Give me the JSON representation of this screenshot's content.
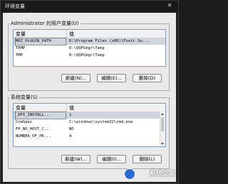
{
  "window": {
    "title": "环境变量",
    "close_glyph": "✕"
  },
  "user_vars": {
    "legend": "Administrator 的用户变量(U)",
    "columns": [
      "变量",
      "值"
    ],
    "rows": [
      {
        "name": "MOZ_PLUGIN_PATH",
        "value": "D:\\Program Files (x86)\\Foxit So...",
        "selected": true
      },
      {
        "name": "TEMP",
        "value": "D:\\QQPCmgr\\Temp"
      },
      {
        "name": "TMP",
        "value": "D:\\QQPCmgr\\Temp"
      }
    ],
    "buttons": {
      "new": "新建(N)...",
      "edit": "编辑(E)...",
      "delete": "删除(D)"
    }
  },
  "sys_vars": {
    "legend": "系统变量(S)",
    "columns": [
      "变量",
      "值"
    ],
    "rows": [
      {
        "name": "_DFX_INSTALL...",
        "value": "1",
        "selected": true
      },
      {
        "name": "ComSpec",
        "value": "C:\\windows\\system32\\cmd.exe"
      },
      {
        "name": "FP_NO_HOST_C...",
        "value": "NO"
      },
      {
        "name": "NUMBER_OF_PR...",
        "value": "4"
      }
    ],
    "buttons": {
      "new": "新建(W)...",
      "edit": "编辑(I)...",
      "delete": "删除(L)"
    }
  },
  "watermark": {
    "text": "系统之家"
  }
}
